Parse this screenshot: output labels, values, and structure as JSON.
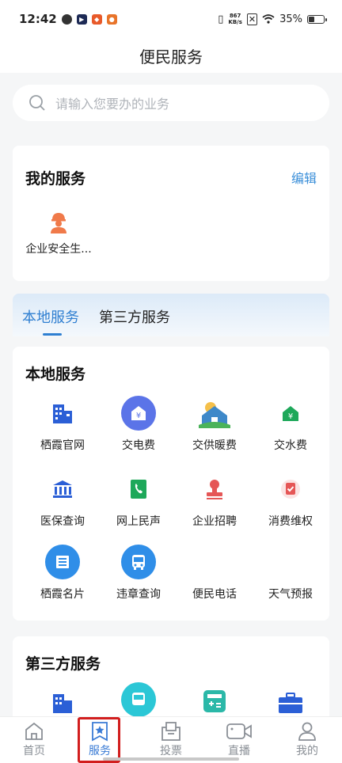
{
  "status": {
    "time": "12:42",
    "net_speed_value": "867",
    "net_speed_unit": "KB/s",
    "battery": "35%",
    "battery_level": 0.35
  },
  "header": {
    "title": "便民服务"
  },
  "search": {
    "placeholder": "请输入您要办的业务"
  },
  "my_services": {
    "title": "我的服务",
    "edit_label": "编辑",
    "items": [
      {
        "label": "企业安全生...",
        "icon": "worker-icon"
      }
    ]
  },
  "tabs": [
    {
      "label": "本地服务",
      "active": true
    },
    {
      "label": "第三方服务",
      "active": false
    }
  ],
  "local_services": {
    "title": "本地服务",
    "items": [
      {
        "label": "栖霞官网",
        "icon": "building-icon"
      },
      {
        "label": "交电费",
        "icon": "yuan-icon"
      },
      {
        "label": "交供暖费",
        "icon": "house-heating-icon"
      },
      {
        "label": "交水费",
        "icon": "water-fee-icon"
      },
      {
        "label": "医保查询",
        "icon": "bank-icon"
      },
      {
        "label": "网上民声",
        "icon": "phone-book-icon"
      },
      {
        "label": "企业招聘",
        "icon": "stamp-icon"
      },
      {
        "label": "消费维权",
        "icon": "shield-check-icon"
      },
      {
        "label": "栖霞名片",
        "icon": "card-icon"
      },
      {
        "label": "违章查询",
        "icon": "bus-icon"
      },
      {
        "label": "便民电话",
        "icon": ""
      },
      {
        "label": "天气预报",
        "icon": ""
      }
    ]
  },
  "third_party_services": {
    "title": "第三方服务",
    "items": [
      {
        "icon": "building-icon"
      },
      {
        "icon": "bus-icon"
      },
      {
        "icon": "calculator-icon"
      },
      {
        "icon": "briefcase-icon"
      }
    ]
  },
  "bottom_nav": [
    {
      "label": "首页",
      "icon": "home-icon",
      "active": false
    },
    {
      "label": "服务",
      "icon": "service-star-icon",
      "active": true
    },
    {
      "label": "投票",
      "icon": "vote-box-icon",
      "active": false
    },
    {
      "label": "直播",
      "icon": "video-camera-icon",
      "active": false
    },
    {
      "label": "我的",
      "icon": "user-icon",
      "active": false
    }
  ],
  "colors": {
    "accent": "#3a7bd5",
    "highlight_box": "#d21e1e",
    "edit": "#3b8fd9"
  }
}
